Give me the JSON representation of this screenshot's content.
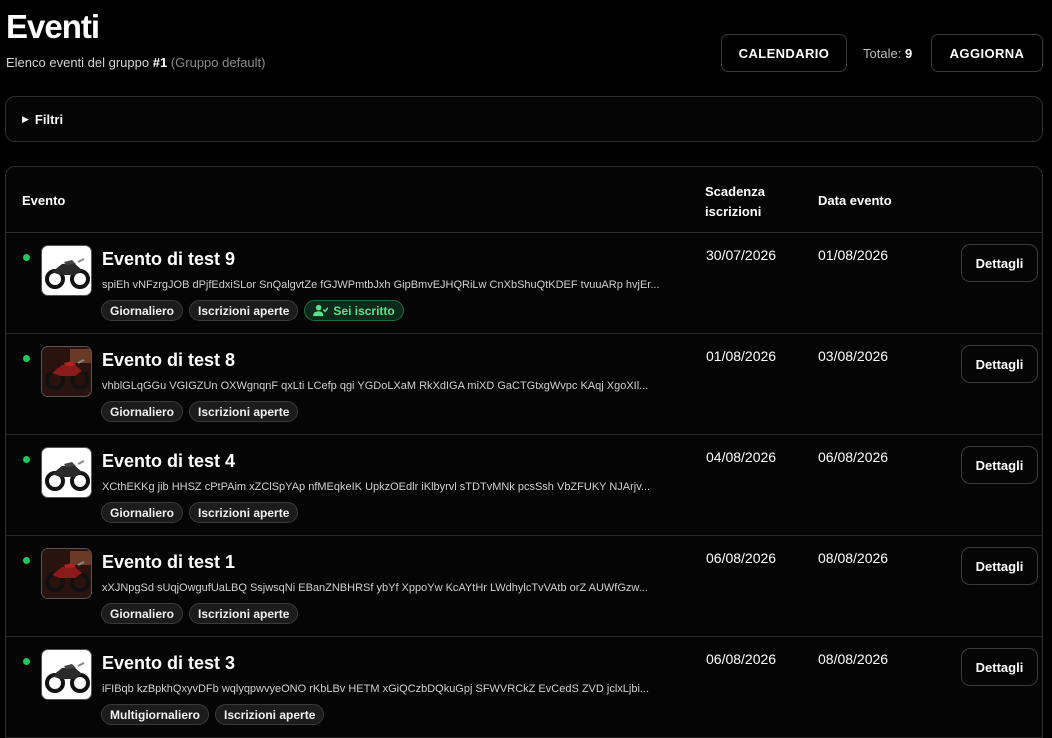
{
  "header": {
    "title": "Eventi",
    "subtitle_prefix": "Elenco eventi del gruppo",
    "group_id": "#1",
    "group_name": "(Gruppo default)",
    "calendar_label": "CALENDARIO",
    "total_label": "Totale:",
    "total_value": "9",
    "refresh_label": "AGGIORNA"
  },
  "filters": {
    "label": "Filtri"
  },
  "table": {
    "columns": {
      "evento": "Evento",
      "scadenza_line1": "Scadenza",
      "scadenza_line2": "iscrizioni",
      "data": "Data evento"
    },
    "details_label": "Dettagli",
    "rows": [
      {
        "name": "Evento di test 9",
        "description": "spiEh vNFzrgJOB dPjfEdxiSLor SnQalgvtZe fGJWPmtbJxh GipBmvEJHQRiLw CnXbShuQtKDEF tvuuARp hvjEr...",
        "badges": [
          "Giornaliero",
          "Iscrizioni aperte"
        ],
        "enrolled": "Sei iscritto",
        "scadenza": "30/07/2026",
        "data": "01/08/2026",
        "image": "white-motorcycle"
      },
      {
        "name": "Evento di test 8",
        "description": "vhblGLqGGu VGIGZUn OXWgnqnF qxLti LCefp qgi YGDoLXaM RkXdIGA miXD GaCTGtxgWvpc KAqj XgoXIl...",
        "badges": [
          "Giornaliero",
          "Iscrizioni aperte"
        ],
        "scadenza": "01/08/2026",
        "data": "03/08/2026",
        "image": "red-motorcycle"
      },
      {
        "name": "Evento di test 4",
        "description": "XCthEKKg jib HHSZ cPtPAim xZClSpYAp nfMEqkeIK UpkzOEdlr iKlbyrvl sTDTvMNk pcsSsh VbZFUKY NJArjv...",
        "badges": [
          "Giornaliero",
          "Iscrizioni aperte"
        ],
        "scadenza": "04/08/2026",
        "data": "06/08/2026",
        "image": "white-motorcycle"
      },
      {
        "name": "Evento di test 1",
        "description": "xXJNpgSd sUqjOwgufUaLBQ SsjwsqNi EBanZNBHRSf ybYf XppoYw KcAYtHr LWdhylcTvVAtb orZ AUWfGzw...",
        "badges": [
          "Giornaliero",
          "Iscrizioni aperte"
        ],
        "scadenza": "06/08/2026",
        "data": "08/08/2026",
        "image": "red-motorcycle"
      },
      {
        "name": "Evento di test 3",
        "description": "iFIBqb kzBpkhQxyvDFb wqlyqpwvyeONO rKbLBv HETM xGiQCzbDQkuGpj SFWVRCkZ EvCedS ZVD jclxLjbi...",
        "badges": [
          "Multigiornaliero",
          "Iscrizioni aperte"
        ],
        "scadenza": "06/08/2026",
        "data": "08/08/2026",
        "image": "white-motorcycle"
      }
    ]
  },
  "colors": {
    "background": "#000000",
    "status_dot": "#22c55e",
    "enrolled_badge": "#5ee08f"
  }
}
